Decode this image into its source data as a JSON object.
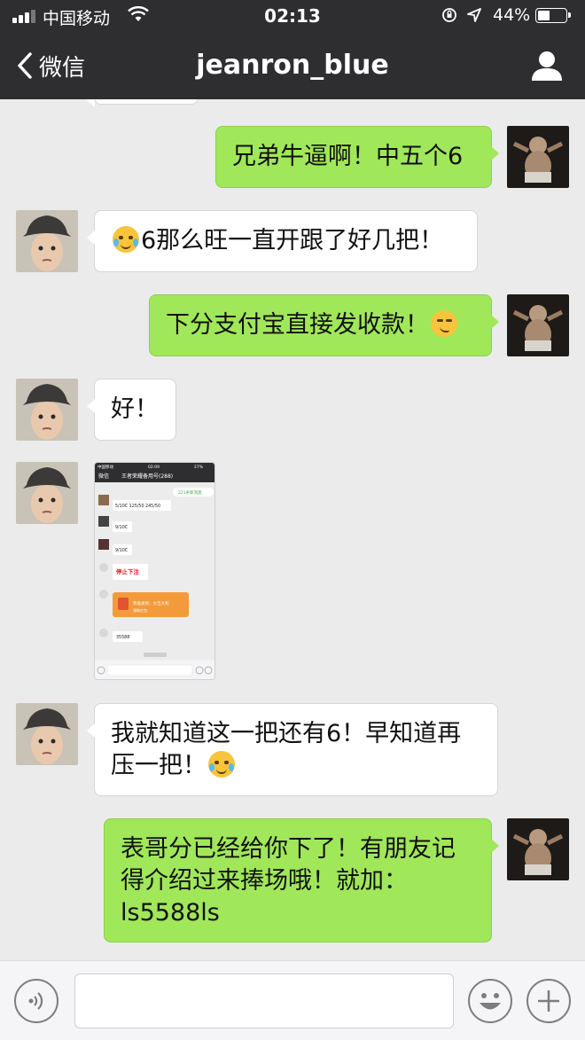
{
  "status_bar": {
    "carrier": "中国移动",
    "time": "02:13",
    "battery_percent": "44%",
    "battery_level": 0.44,
    "icons": [
      "signal-icon",
      "wifi-icon",
      "orientation-lock-icon",
      "location-icon",
      "battery-icon"
    ]
  },
  "nav": {
    "back_label": "微信",
    "title": "jeanron_blue",
    "icons": [
      "chevron-left-icon",
      "profile-icon"
    ]
  },
  "messages": [
    {
      "side": "right",
      "text": "兄弟牛逼啊！中五个6"
    },
    {
      "side": "left",
      "text": "6那么旺一直开跟了好几把！",
      "leading_emoji": "crying-laughing-emoji"
    },
    {
      "side": "right",
      "text": "下分支付宝直接发收款！",
      "trailing_emoji": "smirk-emoji"
    },
    {
      "side": "left",
      "text": "好！"
    },
    {
      "side": "left",
      "type": "image"
    },
    {
      "side": "left",
      "line1": "我就知道这一把还有6！早知道再",
      "line2": "压一把！",
      "trailing_emoji": "crying-laughing-emoji"
    },
    {
      "side": "right",
      "line1": "表哥分已经给你下了！有朋友记",
      "line2": "得介绍过来捧场哦！就加：",
      "line3": "ls5588ls"
    }
  ],
  "screenshot_in_image": {
    "carrier": "中国移动",
    "time": "02:09",
    "battery": "27%",
    "back": "微信",
    "title": "王者荣耀备用号(288)",
    "new_messages": "221条新消息",
    "bets": [
      "5/10C 125/50 245/50",
      "9/10C",
      "9/10C"
    ],
    "stop_label": "停止下注",
    "red_packet_text": "恭喜发财，大吉大利",
    "red_packet_sub": "领取红包",
    "last_msg": "35588"
  },
  "input_bar": {
    "placeholder": "",
    "icons": [
      "voice-icon",
      "emoji-icon",
      "plus-icon"
    ]
  },
  "colors": {
    "nav_bg": "#2e2e30",
    "chat_bg": "#ebebeb",
    "outgoing_bubble": "#a0e75a",
    "incoming_bubble": "#ffffff"
  }
}
